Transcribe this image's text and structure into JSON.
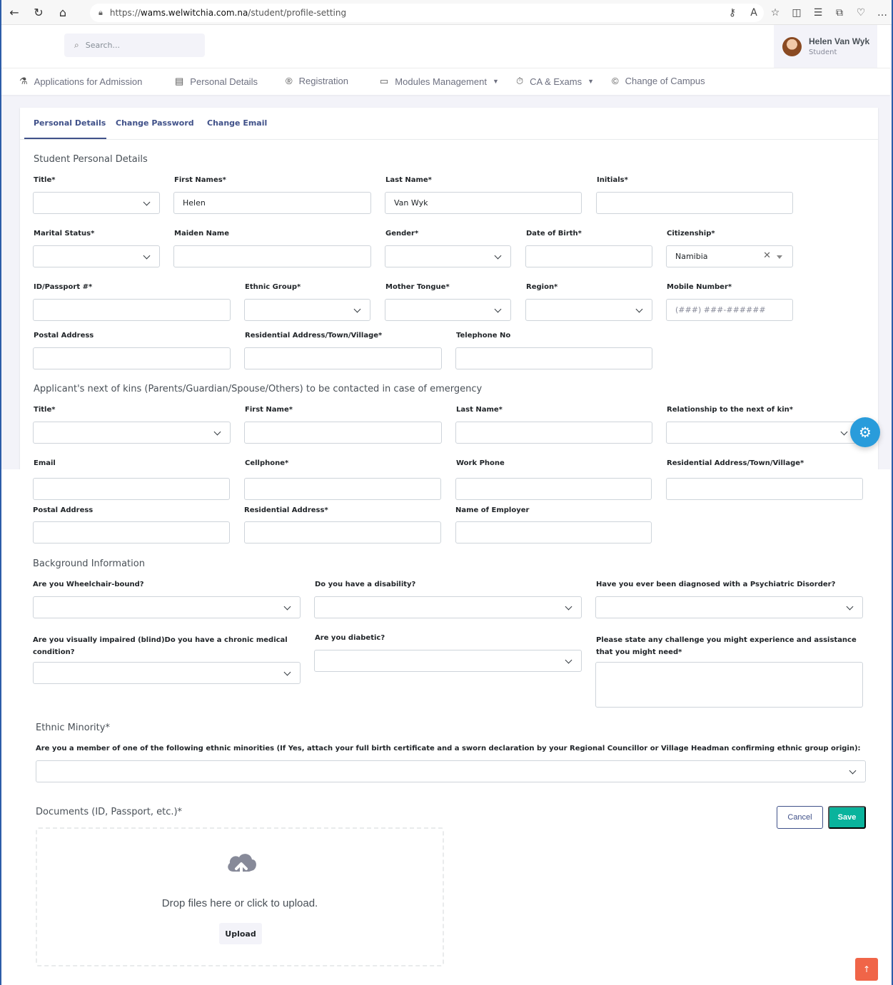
{
  "browser": {
    "url_prefix": "https://",
    "url_host": "wams.welwitchia.com.na",
    "url_path": "/student/profile-setting"
  },
  "topbar": {
    "search_placeholder": "Search...",
    "user_name": "Helen Van Wyk",
    "user_role": "Student"
  },
  "nav": {
    "items": [
      {
        "label": "Applications for Admission",
        "icon": "flask-icon"
      },
      {
        "label": "Personal Details",
        "icon": "id-card-icon"
      },
      {
        "label": "Registration",
        "icon": "registered-icon"
      },
      {
        "label": "Modules Management",
        "icon": "module-icon",
        "caret": true
      },
      {
        "label": "CA & Exams",
        "icon": "timer-icon",
        "caret": true
      },
      {
        "label": "Change of Campus",
        "icon": "copyright-icon"
      }
    ]
  },
  "tabs": [
    "Personal Details",
    "Change Password",
    "Change Email"
  ],
  "student": {
    "title": "Student Personal Details",
    "labels": {
      "title": "Title*",
      "first_names": "First Names*",
      "last_name": "Last Name*",
      "initials": "Initials*",
      "marital_status": "Marital Status*",
      "maiden_name": "Maiden Name",
      "gender": "Gender*",
      "dob": "Date of Birth*",
      "citizenship": "Citizenship*",
      "id_passport": "ID/Passport #*",
      "ethnic_group": "Ethnic Group*",
      "mother_tongue": "Mother Tongue*",
      "region": "Region*",
      "mobile": "Mobile Number*",
      "postal": "Postal Address",
      "residential": "Residential Address/Town/Village*",
      "telephone": "Telephone No"
    },
    "values": {
      "first_names": "Helen",
      "last_name": "Van Wyk",
      "citizenship": "Namibia"
    },
    "mobile_placeholder": "(###) ###-######"
  },
  "kin": {
    "title": "Applicant's next of kins (Parents/Guardian/Spouse/Others) to be contacted in case of emergency",
    "labels": {
      "title": "Title*",
      "first_name": "First Name*",
      "last_name": "Last Name*",
      "relationship": "Relationship to the next of kin*",
      "email": "Email",
      "cellphone": "Cellphone*",
      "work_phone": "Work Phone",
      "residential_town": "Residential Address/Town/Village*",
      "postal": "Postal Address",
      "residential": "Residential Address*",
      "employer": "Name of Employer"
    }
  },
  "background": {
    "title": "Background Information",
    "q_wheelchair": "Are you Wheelchair-bound?",
    "q_disability": "Do you have a disability?",
    "q_psychiatric": "Have you ever been diagnosed with a Psychiatric Disorder?",
    "q_visual": "Are you visually impaired (blind)Do you have a chronic medical condition?",
    "q_diabetic": "Are you diabetic?",
    "q_challenge": "Please state any challenge you might experience and assistance that you might need*"
  },
  "ethnic": {
    "title": "Ethnic Minority*",
    "question": "Are you a member of one of the following ethnic minorities (If Yes, attach your full birth certificate and a sworn declaration by your Regional Councillor or Village Headman confirming ethnic group origin):"
  },
  "documents": {
    "title": "Documents (ID, Passport, etc.)*",
    "drop_text": "Drop files here or click to upload.",
    "upload_label": "Upload"
  },
  "actions": {
    "cancel": "Cancel",
    "save": "Save"
  },
  "colors": {
    "primary": "#405189",
    "success": "#0ab39c",
    "info": "#299cdb",
    "danger": "#f06548"
  }
}
